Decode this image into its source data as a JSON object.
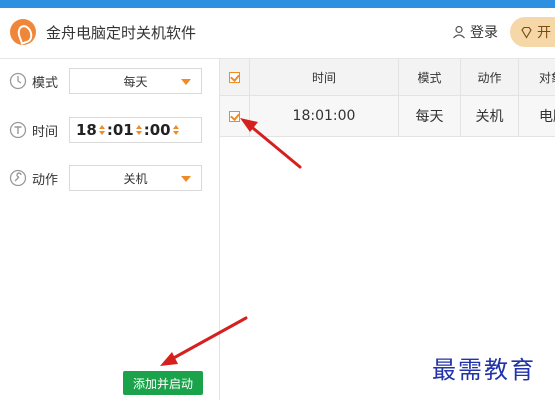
{
  "app": {
    "title": "金舟电脑定时关机软件"
  },
  "header": {
    "login_label": "登录",
    "open_label": "开"
  },
  "form": {
    "mode_label": "模式",
    "mode_value": "每天",
    "time_label": "时间",
    "time_h": "18",
    "time_sep1": ":01",
    "time_sep2": ":00",
    "action_label": "动作",
    "action_value": "关机",
    "add_button": "添加并启动"
  },
  "table": {
    "headers": [
      "时间",
      "模式",
      "动作",
      "对象"
    ],
    "rows": [
      {
        "time": "18:01:00",
        "mode": "每天",
        "action": "关机",
        "target": "电脑"
      }
    ]
  },
  "watermark": "最需教育",
  "colors": {
    "accent": "#f08a24",
    "green": "#1aa34a",
    "topbar": "#2d90e0",
    "arrow": "#d62020"
  }
}
